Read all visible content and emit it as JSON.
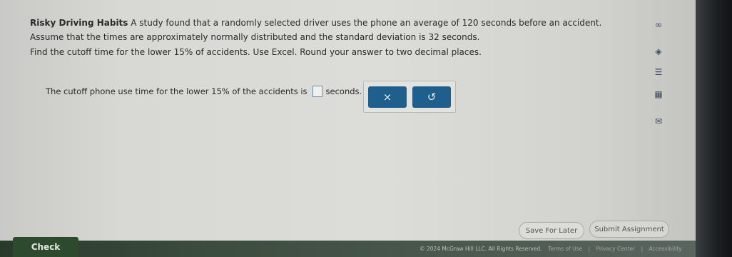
{
  "question": {
    "title": "Risky Driving Habits",
    "body": "A study found that a randomly selected driver uses the phone an average of 120 seconds before an accident. Assume that the times are approximately normally distributed and the standard deviation is 32 seconds."
  },
  "instruction": "Find the cutoff time for the lower 15% of accidents. Use Excel. Round your answer to two decimal places.",
  "answer": {
    "prefix": "The cutoff phone use time for the lower 15% of the accidents is",
    "value": "",
    "suffix": "seconds."
  },
  "tools": {
    "clear_label": "×",
    "undo_label": "↺"
  },
  "side_icons": [
    "infinity-icon",
    "compass-icon",
    "notes-icon",
    "calculator-icon",
    "mail-icon"
  ],
  "side_glyphs": {
    "infinity": "∞",
    "compass": "◈",
    "notes": "☰",
    "calculator": "▦",
    "mail": "✉"
  },
  "buttons": {
    "save": "Save For Later",
    "submit": "Submit Assignment",
    "check": "Check"
  },
  "footer": {
    "copyright": "© 2024 McGraw Hill LLC. All Rights Reserved.",
    "terms": "Terms of Use",
    "privacy": "Privacy Center",
    "accessibility": "Accessibility"
  }
}
